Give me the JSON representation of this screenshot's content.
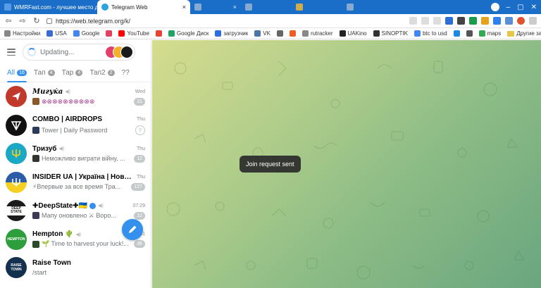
{
  "browser": {
    "tabs": [
      {
        "title": "WMRFast.com - лучшее место дл",
        "active": false,
        "favicon_color": "#5a9be8"
      },
      {
        "title": "Telegram Web",
        "active": true,
        "favicon_color": "#2aa3df"
      },
      {
        "title": "",
        "active": false,
        "favicon_color": "#9ab5d6"
      },
      {
        "title": "",
        "active": false,
        "favicon_color": "#9ab5d6"
      },
      {
        "title": "",
        "active": false,
        "favicon_color": "#f0b73a"
      },
      {
        "title": "",
        "active": false,
        "favicon_color": "#9ab5d6"
      }
    ],
    "close_glyph": "×",
    "url": "https://web.telegram.org/k/",
    "bookmarks": [
      {
        "label": "Настройки",
        "color": "#888"
      },
      {
        "label": "USA",
        "color": "#3b6bd1"
      },
      {
        "label": "Google",
        "color": "#4285f4"
      },
      {
        "label": "",
        "color": "#e4405f"
      },
      {
        "label": "YouTube",
        "color": "#ff0000"
      },
      {
        "label": "",
        "color": "#ea4335"
      },
      {
        "label": "Google Диск",
        "color": "#1fa463"
      },
      {
        "label": "загрузчик",
        "color": "#2c6ee0"
      },
      {
        "label": "VK",
        "color": "#4a76a8"
      },
      {
        "label": "",
        "color": "#666"
      },
      {
        "label": "",
        "color": "#f25c22"
      },
      {
        "label": "rutracker",
        "color": "#888"
      },
      {
        "label": "UAKino",
        "color": "#222"
      },
      {
        "label": "SINOPTIK",
        "color": "#333"
      },
      {
        "label": "btc to usd",
        "color": "#4285f4"
      },
      {
        "label": "",
        "color": "#1e88e5"
      },
      {
        "label": "",
        "color": "#555"
      },
      {
        "label": "maps",
        "color": "#34a853"
      }
    ],
    "other_bookmarks": "Другие закладки"
  },
  "telegram": {
    "search_placeholder": "Updating...",
    "folders": [
      {
        "label": "All",
        "count": "16",
        "active": true
      },
      {
        "label": "Тап",
        "count": "4",
        "active": false
      },
      {
        "label": "Тар",
        "count": "4",
        "active": false
      },
      {
        "label": "Тап2",
        "count": "2",
        "active": false
      },
      {
        "label": "??",
        "count": "",
        "active": false
      }
    ],
    "chats": [
      {
        "title": "Мигуќа",
        "time": "Wed",
        "message": "⊗⊗⊗⊗⊗⊗⊗⊗⊗⊗",
        "badge": "31",
        "avatar_color": "#c0392b",
        "avatar_text": ""
      },
      {
        "title": "COMBO | AIRDROPS",
        "time": "Thu",
        "message": "Tower | Daily Password",
        "badge": "",
        "avatar_color": "#111111",
        "avatar_text": ""
      },
      {
        "title": "Тризуб",
        "time": "Thu",
        "message": "Неможливо виграти війну, ...",
        "badge": "12",
        "avatar_color": "#1aa8c4",
        "avatar_text": ""
      },
      {
        "title": "INSIDER UA | Україна | Новини",
        "time": "Thu",
        "message": "⚡Впервые за все время Тра...",
        "badge": "127",
        "avatar_color": "#2a5ca8",
        "avatar_text": ""
      },
      {
        "title": "✚DeepState✚🇺🇦",
        "time": "07:29",
        "message": "Мапу оновлено ⚔ Воро...",
        "badge": "12",
        "avatar_color": "#1b1b1b",
        "avatar_text": "DEEP STATE"
      },
      {
        "title": "Hempton 🌵",
        "time": "12:31",
        "message": "🌱 Time to harvest your luck!...",
        "badge": "36",
        "avatar_color": "#2e9e3c",
        "avatar_text": "HEMPTON"
      },
      {
        "title": "Raise Town",
        "time": "",
        "message": "/start",
        "badge": "",
        "avatar_color": "#13304f",
        "avatar_text": "RAISE TOWN"
      }
    ],
    "toast": "Join request sent"
  }
}
